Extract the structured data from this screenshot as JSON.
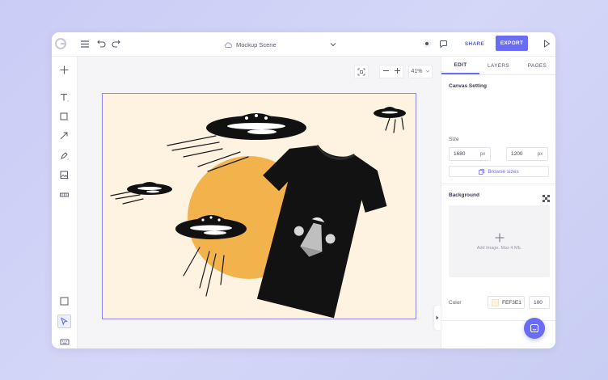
{
  "topbar": {
    "doc_title": "Mockup Scene",
    "share_label": "SHARE",
    "export_label": "EXPORT"
  },
  "workspace": {
    "zoom": "41%"
  },
  "panel": {
    "tabs": [
      {
        "label": "EDIT"
      },
      {
        "label": "LAYERS"
      },
      {
        "label": "PAGES"
      }
    ],
    "canvas_setting_title": "Canvas Setting",
    "size_label": "Size",
    "width_value": "1680",
    "height_value": "1200",
    "unit": "px",
    "browse_sizes_label": "Browse sizes",
    "background_title": "Background",
    "upload_text": "Add Image. Max 4 Mb.",
    "color_label": "Color",
    "color_hex": "FEF3E1",
    "opacity_value": "100"
  },
  "colors": {
    "accent": "#6a6cf5",
    "canvas_background": "#fef3e1",
    "sun": "#f2b24c"
  }
}
